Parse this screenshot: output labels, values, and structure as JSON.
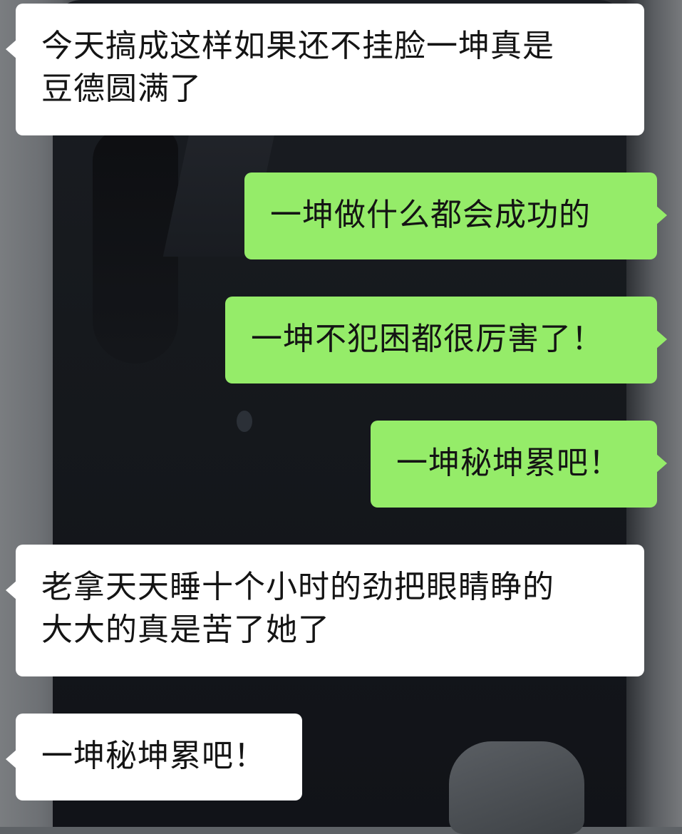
{
  "chat": {
    "messages": [
      {
        "side": "left",
        "lines": [
          "今天搞成这样如果还不挂脸一坤真是",
          "豆德圆满了"
        ]
      },
      {
        "side": "right",
        "lines": [
          "一坤做什么都会成功的"
        ]
      },
      {
        "side": "right",
        "lines": [
          "一坤不犯困都很厉害了！"
        ]
      },
      {
        "side": "right",
        "lines": [
          "一坤秘坤累吧！"
        ]
      },
      {
        "side": "left",
        "lines": [
          "老拿天天睡十个小时的劲把眼睛睁的",
          "大大的真是苦了她了"
        ]
      },
      {
        "side": "left",
        "lines": [
          "一坤秘坤累吧！"
        ]
      }
    ]
  },
  "colors": {
    "incoming_bubble": "#ffffff",
    "outgoing_bubble": "#95ec69",
    "text": "#141414"
  }
}
